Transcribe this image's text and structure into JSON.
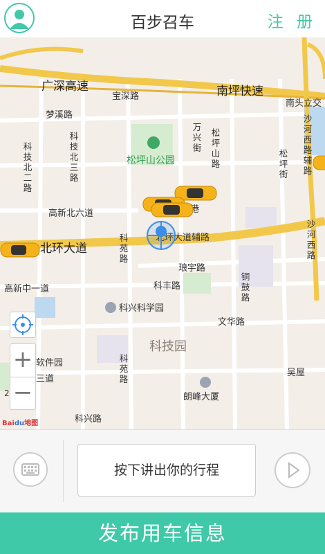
{
  "header": {
    "title": "百步召车",
    "register_label": "注 册"
  },
  "map": {
    "roads_horizontal": [
      "广深高速",
      "南坪快速",
      "北环大道",
      "北环大道辅路",
      "南头立交"
    ],
    "street_labels": {
      "baoshen": "宝深路",
      "mengxi": "梦溪路",
      "gaoxin_bei6": "高新北六道",
      "gaoxin_zhong1": "高新中一道",
      "langyu": "琅宇路",
      "keji": "科丰路",
      "wenxin": "文华路",
      "keyuan_label": "科苑路",
      "keyuan2": "科苑路",
      "keji_bei3": "科技北三路",
      "keji_bei2": "科技北二路",
      "wanxing": "万兴街",
      "songping_shan": "松坪山路",
      "songping_jie": "松坪街",
      "shahe_xi_fu": "沙河西路辅路",
      "shahe_xi": "沙河西路",
      "tonggu": "铜鼓路",
      "kejitian": "科兴科学园",
      "ruanjian": "软件园",
      "sanlu": "三道",
      "keyuan_bottom": "科兴路",
      "xin_gang": "恩港",
      "park": "松坪山公园",
      "area_keji": "科技园",
      "langfeng": "朗峰大厦",
      "wuwu": "吴屋"
    },
    "zoom_in_label": "+",
    "zoom_out_label": "−",
    "scale_text": "2",
    "baidu_logo_a": "Bai",
    "baidu_logo_b": "du",
    "baidu_logo_c": "地图"
  },
  "input_bar": {
    "speak_label": "按下讲出你的行程"
  },
  "publish_label": "发布用车信息",
  "colors": {
    "accent": "#3fc9a8",
    "highway": "#f2c84b",
    "taxi": "#f6b21a"
  },
  "icons": {
    "avatar": "user-avatar-icon",
    "keyboard": "keyboard-icon",
    "play": "play-icon",
    "locate": "locate-icon",
    "location_marker": "location-marker-icon",
    "taxi": "taxi-icon"
  }
}
